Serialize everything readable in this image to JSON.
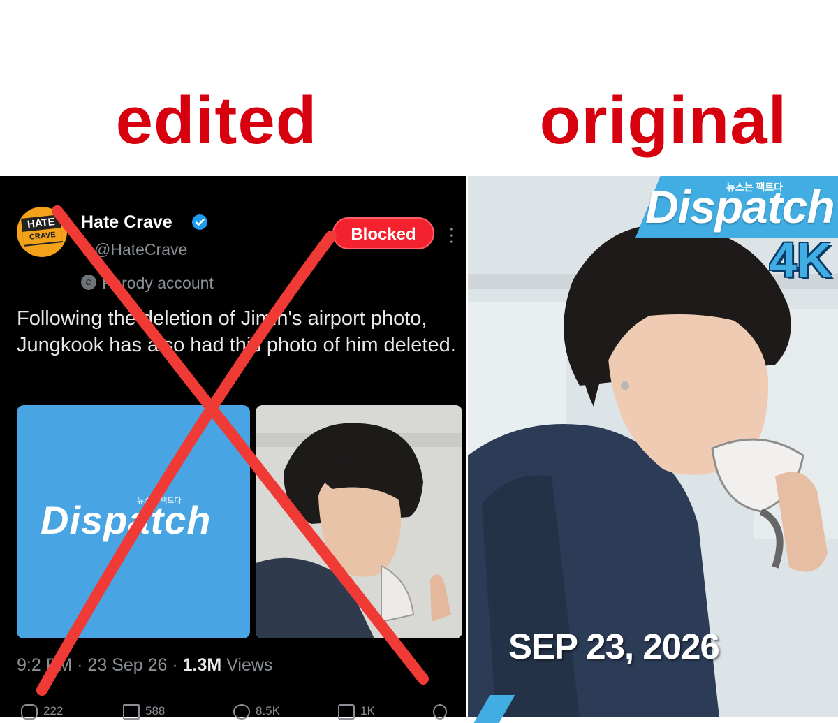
{
  "headings": {
    "left": "edited",
    "right": "original"
  },
  "tweet": {
    "avatar_text": [
      "HATE",
      "CRAVE"
    ],
    "display_name": "Hate Crave",
    "handle": "@HateCrave",
    "parody_label": "Parody account",
    "blocked_label": "Blocked",
    "text": "Following the deletion of Jimin's airport photo, Jungkook has also had this photo of him deleted.",
    "media_logo": "Dispatch",
    "media_tagline": "뉴스는 팩트다",
    "meta": {
      "time": "9:2  PM",
      "date": "23 Sep 26",
      "views_count": "1.3M",
      "views_label": "Views"
    },
    "actions": [
      "222",
      "588",
      "8.5K",
      "1K"
    ]
  },
  "original": {
    "logo": "Dispatch",
    "tagline": "뉴스는 팩트다",
    "badge": "4K",
    "date": "SEP 23, 2026"
  },
  "colors": {
    "heading": "#d7000f",
    "x_mark": "#f03a35",
    "blocked": "#f4212e",
    "dispatch_blue": "#41ade3"
  }
}
